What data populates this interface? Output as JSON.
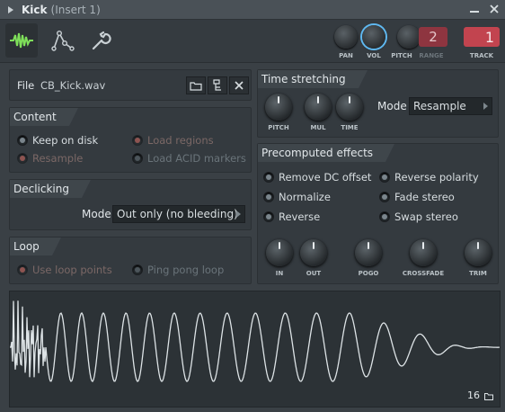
{
  "window": {
    "title": "Kick",
    "subtitle": "(Insert 1)"
  },
  "toolbar": {
    "tabs": [
      {
        "name": "waveform-tab",
        "icon": "waveform-icon",
        "active": true
      },
      {
        "name": "envelope-tab",
        "icon": "envelope-icon",
        "active": false
      },
      {
        "name": "settings-tab",
        "icon": "wrench-icon",
        "active": false
      }
    ],
    "pan_label": "PAN",
    "vol_label": "VOL",
    "pitch_label": "PITCH",
    "range_label": "RANGE",
    "range_value": "2",
    "track_label": "TRACK",
    "track_value": "1"
  },
  "file": {
    "label": "File",
    "name": "CB_Kick.wav"
  },
  "content": {
    "title": "Content",
    "keep_on_disk": "Keep on disk",
    "resample": "Resample",
    "load_regions": "Load regions",
    "load_acid": "Load ACID markers"
  },
  "declicking": {
    "title": "Declicking",
    "mode_label": "Mode",
    "mode_value": "Out only (no bleeding)"
  },
  "loop": {
    "title": "Loop",
    "use_loop_points": "Use loop points",
    "ping_pong": "Ping pong loop"
  },
  "time_stretching": {
    "title": "Time stretching",
    "pitch": "PITCH",
    "mul": "MUL",
    "time": "TIME",
    "mode_label": "Mode",
    "mode_value": "Resample"
  },
  "precomputed": {
    "title": "Precomputed effects",
    "remove_dc": "Remove DC offset",
    "normalize": "Normalize",
    "reverse": "Reverse",
    "reverse_polarity": "Reverse polarity",
    "fade_stereo": "Fade stereo",
    "swap_stereo": "Swap stereo",
    "knob_in": "IN",
    "knob_out": "OUT",
    "knob_pogo": "POGO",
    "knob_crossfade": "CROSSFADE",
    "knob_trim": "TRIM"
  },
  "waveform": {
    "sample_count_label": "16"
  },
  "colors": {
    "accent_green": "#7fe05a",
    "vol_ring": "#5fb8f0",
    "track_red": "#c2444f",
    "range_red": "#8e3540"
  }
}
